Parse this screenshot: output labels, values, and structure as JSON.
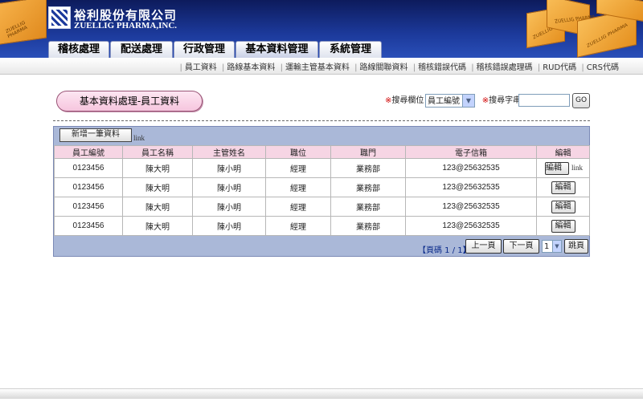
{
  "header": {
    "company_cn": "裕利股份有限公司",
    "company_en": "ZUELLIG PHARMA,INC.",
    "box_label": "ZUELLIG PHARMA",
    "colors": {
      "header_bg": "#1c3a9c",
      "box": "#f0a030"
    }
  },
  "tabs": [
    "稽核處理",
    "配送處理",
    "行政管理",
    "基本資料管理",
    "系統管理"
  ],
  "active_tab": "基本資料管理",
  "subnav": [
    "員工資料",
    "路線基本資料",
    "運輸主管基本資料",
    "路線關聯資料",
    "稽核錯誤代碼",
    "稽核錯誤處理碼",
    "RUD代碼",
    "CRS代碼"
  ],
  "page_title": "基本資料處理-員工資料",
  "search": {
    "required_mark": "※",
    "field_label": "搜尋欄位",
    "field_value": "員工編號",
    "keyword_label": "搜尋字串",
    "keyword_value": "",
    "go_label": "GO"
  },
  "grid": {
    "add_button": "新增一筆資料",
    "add_link": "link",
    "columns": [
      "員工編號",
      "員工名稱",
      "主管姓名",
      "職位",
      "職門",
      "電子信箱",
      "編輯"
    ],
    "rows": [
      [
        "0123456",
        "陳大明",
        "陳小明",
        "經理",
        "業務部",
        "123@25632535",
        "編輯"
      ],
      [
        "0123456",
        "陳大明",
        "陳小明",
        "經理",
        "業務部",
        "123@25632535",
        "編輯"
      ],
      [
        "0123456",
        "陳大明",
        "陳小明",
        "經理",
        "業務部",
        "123@25632535",
        "編輯"
      ],
      [
        "0123456",
        "陳大明",
        "陳小明",
        "經理",
        "業務部",
        "123@25632535",
        "編輯"
      ]
    ],
    "edit_link": "link"
  },
  "pager": {
    "info": "【頁碼 1 / 1】",
    "prev": "上一頁",
    "next": "下一頁",
    "page_value": "1",
    "jump": "跳頁"
  }
}
